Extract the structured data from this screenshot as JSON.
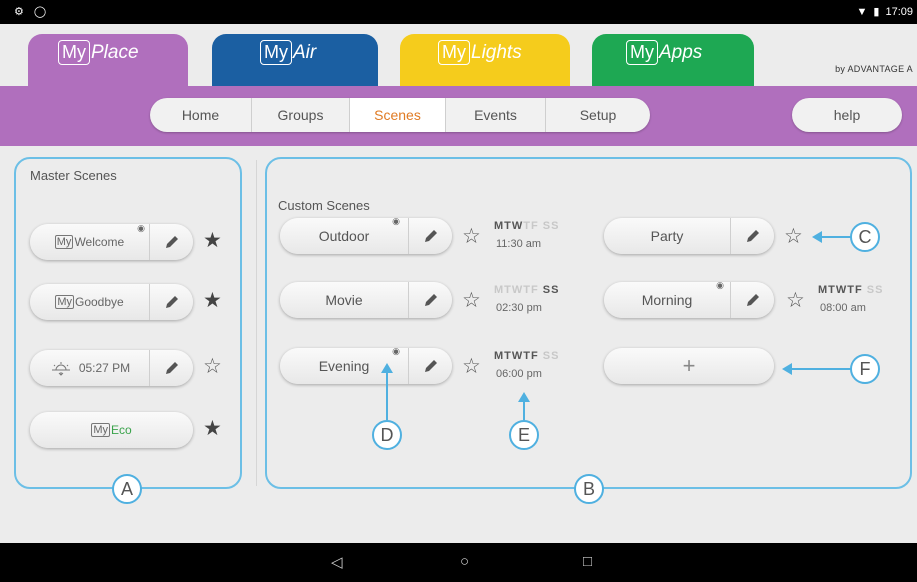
{
  "statusbar": {
    "time": "17:09",
    "left_icons": [
      "notification-icon",
      "alarm-icon"
    ],
    "right_icons": [
      "wifi-icon",
      "battery-icon"
    ]
  },
  "brand_tabs": [
    {
      "my": "My",
      "name": "Place",
      "color": "#b06fbd"
    },
    {
      "my": "My",
      "name": "Air",
      "color": "#1b5fa2"
    },
    {
      "my": "My",
      "name": "Lights",
      "color": "#f5cc1c"
    },
    {
      "my": "My",
      "name": "Apps",
      "color": "#1ea853"
    }
  ],
  "brand_byline": "by ADVANTAGE A",
  "nav": {
    "items": [
      "Home",
      "Groups",
      "Scenes",
      "Events",
      "Setup"
    ],
    "active": "Scenes",
    "help": "help"
  },
  "master": {
    "title": "Master Scenes",
    "scenes": [
      {
        "label": "Welcome",
        "prefix": "My",
        "eye": true,
        "star": "filled"
      },
      {
        "label": "Goodbye",
        "prefix": "My",
        "eye": false,
        "star": "filled"
      },
      {
        "label": "05:27 PM",
        "icon": "sunset-icon",
        "eye": false,
        "star": "empty"
      },
      {
        "label": "Eco",
        "prefix": "My",
        "eye": false,
        "star": "filled"
      }
    ]
  },
  "custom": {
    "title": "Custom Scenes",
    "scenes": [
      {
        "label": "Outdoor",
        "eye": true,
        "star": "empty",
        "days_on": "MTW",
        "days_off": "TF SS",
        "time": "11:30 am"
      },
      {
        "label": "Party",
        "eye": false,
        "star": "empty",
        "days_on": "",
        "days_off": "",
        "time": ""
      },
      {
        "label": "Movie",
        "eye": false,
        "star": "empty",
        "days_on_tail": "SS",
        "days_off": "MTWTF",
        "time": "02:30 pm"
      },
      {
        "label": "Morning",
        "eye": true,
        "star": "empty",
        "days_on": "MTWTF",
        "days_off": "SS",
        "time": "08:00 am"
      },
      {
        "label": "Evening",
        "eye": true,
        "star": "empty",
        "days_on": "MTWTF",
        "days_off": "SS",
        "time": "06:00 pm"
      }
    ],
    "add_label": "+"
  },
  "callouts": [
    "A",
    "B",
    "C",
    "D",
    "E",
    "F"
  ],
  "colors": {
    "accent_blue": "#6cbfe6",
    "nav_purple": "#b06fbd",
    "active_orange": "#e07b24"
  }
}
